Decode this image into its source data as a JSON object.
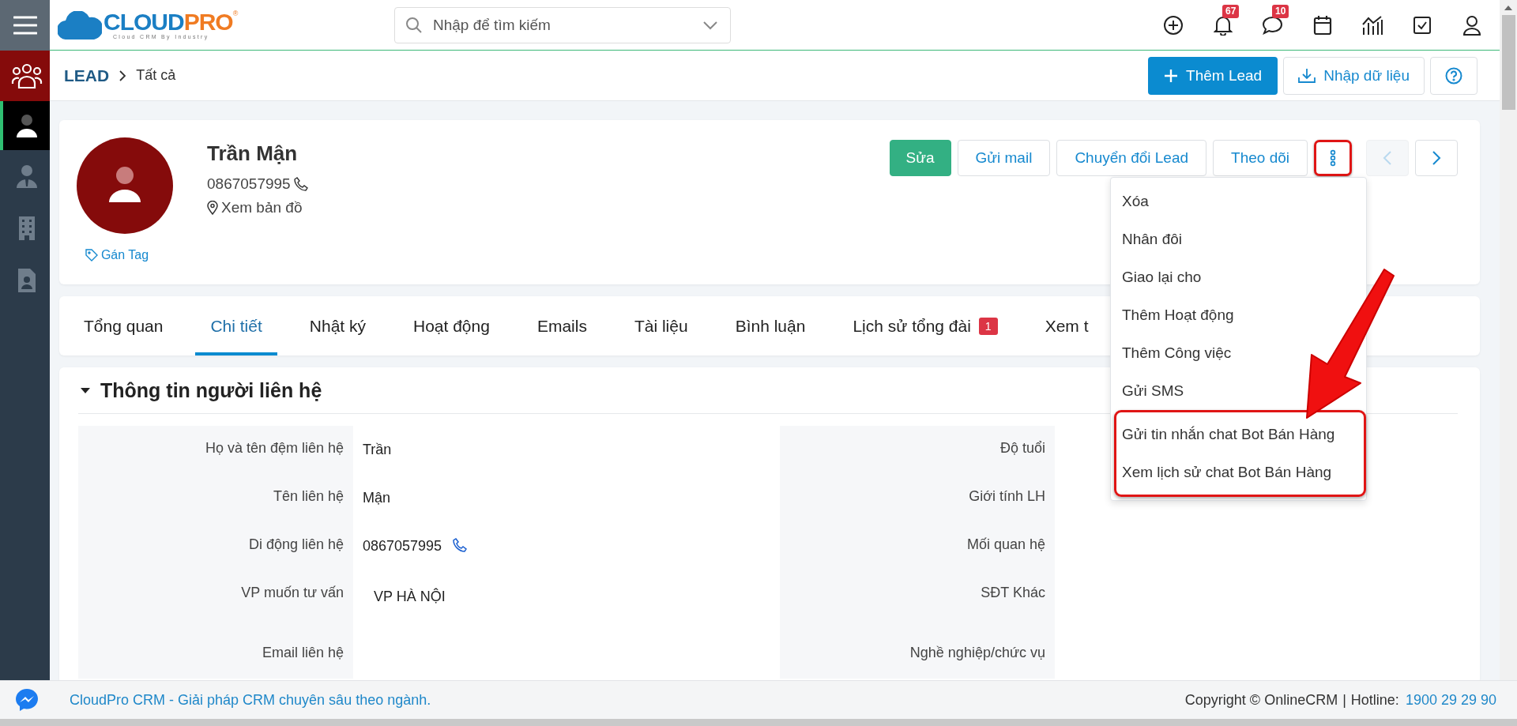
{
  "sidebar": {
    "items": [
      {
        "kind": "group",
        "selected": false
      },
      {
        "kind": "person",
        "selected": true
      },
      {
        "kind": "contact",
        "selected": false
      },
      {
        "kind": "building",
        "selected": false
      },
      {
        "kind": "document",
        "selected": false
      }
    ]
  },
  "logo": {
    "part_1": "CLOUD",
    "part_2": "PRO",
    "tagline": "Cloud CRM By Industry",
    "mark": "®"
  },
  "search": {
    "placeholder": "Nhập để tìm kiếm"
  },
  "header_icons": [
    {
      "kind": "add"
    },
    {
      "kind": "bell",
      "badge": "67"
    },
    {
      "kind": "chat",
      "badge": "10"
    },
    {
      "kind": "calendar"
    },
    {
      "kind": "chart"
    },
    {
      "kind": "task"
    },
    {
      "kind": "user"
    }
  ],
  "breadcrumb": {
    "module": "LEAD",
    "view": "Tất cả"
  },
  "toolbar": {
    "add_button": "Thêm Lead",
    "import_button": "Nhập dữ liệu"
  },
  "profile": {
    "name": "Trần Mận",
    "phone": "0867057995",
    "map_link": "Xem bản đồ",
    "tag_link": "Gán Tag",
    "actions": [
      {
        "label": "Sửa",
        "kind": "primary"
      },
      {
        "label": "Gửi mail",
        "kind": "default"
      },
      {
        "label": "Chuyển đổi Lead",
        "kind": "default"
      },
      {
        "label": "Theo dõi",
        "kind": "default"
      }
    ],
    "more_button": {
      "highlighted": true
    },
    "prev_button": {
      "disabled": true
    },
    "next_button": {
      "disabled": false
    }
  },
  "menu": {
    "items": [
      {
        "label": "Xóa",
        "highlighted": false
      },
      {
        "label": "Nhân đôi",
        "highlighted": false
      },
      {
        "label": "Giao lại cho",
        "highlighted": false
      },
      {
        "label": "Thêm Hoạt động",
        "highlighted": false
      },
      {
        "label": "Thêm Công việc",
        "highlighted": false
      },
      {
        "label": "Gửi SMS",
        "highlighted": false
      },
      {
        "label": "Gửi tin nhắn chat Bot Bán Hàng",
        "highlighted": true
      },
      {
        "label": "Xem lịch sử chat Bot Bán Hàng",
        "highlighted": true
      }
    ]
  },
  "tabs": [
    {
      "label": "Tổng quan",
      "selected": false
    },
    {
      "label": "Chi tiết",
      "selected": true
    },
    {
      "label": "Nhật ký",
      "selected": false
    },
    {
      "label": "Hoạt động",
      "selected": false
    },
    {
      "label": "Emails",
      "selected": false
    },
    {
      "label": "Tài liệu",
      "selected": false
    },
    {
      "label": "Bình luận",
      "selected": false
    },
    {
      "label": "Lịch sử tổng đài",
      "selected": false,
      "badge": "1"
    },
    {
      "label": "Xem t",
      "selected": false
    }
  ],
  "section": {
    "title": "Thông tin người liên hệ",
    "expanded": true,
    "left_fields": [
      {
        "label": "Họ và tên đệm liên hệ",
        "value": "Trần",
        "kind": "text"
      },
      {
        "label": "Tên liên hệ",
        "value": "Mận",
        "kind": "text"
      },
      {
        "label": "Di động liên hệ",
        "value": "0867057995",
        "kind": "phone"
      },
      {
        "label": "VP muốn tư vấn",
        "value": "VP HÀ NỘI",
        "kind": "option"
      },
      {
        "label": "Email liên hệ",
        "kind": "text"
      }
    ],
    "right_fields": [
      {
        "label": "Độ tuổi"
      },
      {
        "label": "Giới tính LH"
      },
      {
        "label": "Mối quan hệ"
      },
      {
        "label": "SĐT Khác"
      },
      {
        "label": "Nghề nghiệp/chức vụ"
      }
    ]
  },
  "footer": {
    "slogan": "CloudPro CRM - Giải pháp CRM chuyên sâu theo ngành.",
    "copyright": "Copyright © OnlineCRM",
    "separator": "|",
    "hotline_label": "Hotline:",
    "hotline": "1900 29 29 90"
  }
}
